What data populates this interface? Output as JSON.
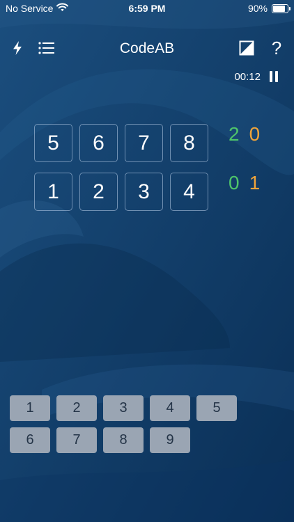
{
  "status_bar": {
    "carrier": "No Service",
    "time": "6:59 PM",
    "battery_label": "90%",
    "battery_level": 0.9,
    "wifi_icon": "wifi-icon"
  },
  "nav": {
    "title": "CodeAB",
    "left_icons": [
      "lightning-icon",
      "list-icon"
    ],
    "right_icons": [
      "contrast-icon",
      "help-icon"
    ],
    "help_glyph": "?"
  },
  "timer": {
    "elapsed": "00:12",
    "pause_icon": "pause-icon"
  },
  "guesses": [
    {
      "digits": [
        "5",
        "6",
        "7",
        "8"
      ],
      "a": "2",
      "b": "0"
    },
    {
      "digits": [
        "1",
        "2",
        "3",
        "4"
      ],
      "a": "0",
      "b": "1"
    }
  ],
  "keypad": {
    "rows": [
      [
        "1",
        "2",
        "3",
        "4",
        "5"
      ],
      [
        "6",
        "7",
        "8",
        "9"
      ]
    ]
  },
  "colors": {
    "background": "#0e3a66",
    "score_a": "#4fc56a",
    "score_b": "#f0a43a",
    "key_bg": "#9aa5b3"
  }
}
